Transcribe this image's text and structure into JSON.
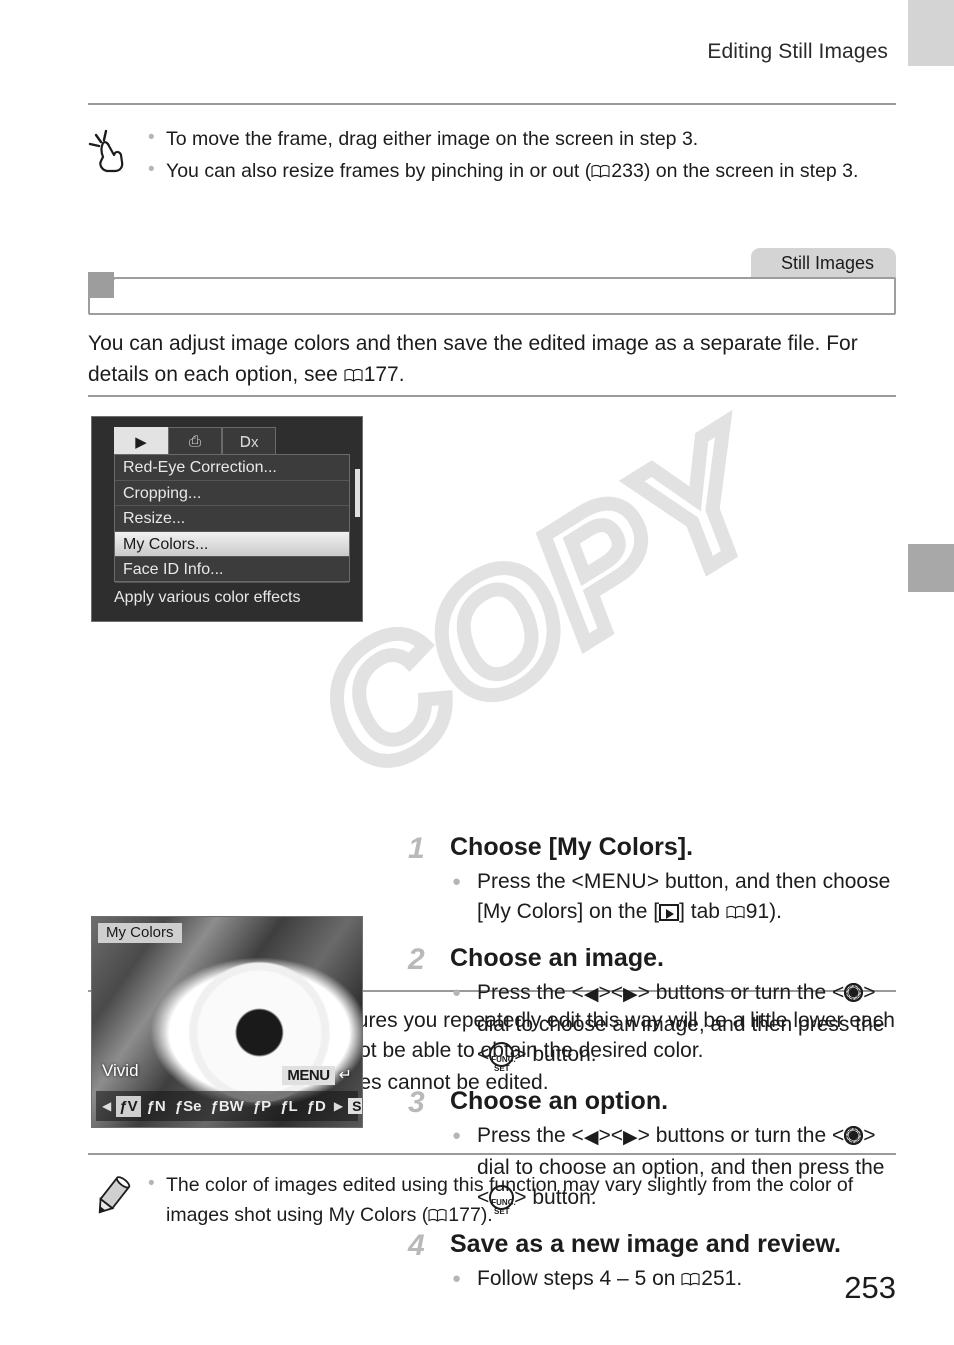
{
  "page": {
    "running_header": "Editing Still Images",
    "page_number": "253"
  },
  "edge_tabs": {
    "top_marker_color": "#d4d4d4",
    "section_marker_color": "#a8a8a8"
  },
  "tip_note": {
    "icon": "tap-hand-icon",
    "bullets": [
      "To move the frame, drag either image on the screen in step 3.",
      "You can also resize frames by pinching in or out ( 233) on the screen in step 3."
    ],
    "bullet2_parts": {
      "before": "You can also resize frames by pinching in or out (",
      "ref_page": "233",
      "after": ") on the screen in step 3."
    }
  },
  "section": {
    "still_images_tab": "Still Images",
    "heading_title": "",
    "intro_before": "You can adjust image colors and then save the edited image as a separate file. For details on each option, see ",
    "intro_ref": "177",
    "intro_after": "."
  },
  "screens": {
    "menu": {
      "name": "camera-menu-screen",
      "tabs": [
        "play-tab",
        "print-tab",
        "settings-tab"
      ],
      "tab_glyphs": [
        "▶",
        "⎙",
        "ƔТ"
      ],
      "rows": [
        "Red-Eye Correction...",
        "Cropping...",
        "Resize...",
        "My Colors...",
        "Face ID Info..."
      ],
      "selected_row_index": 3,
      "hint": "Apply various color effects"
    },
    "photo": {
      "name": "my-colors-preview-screen",
      "label": "My Colors",
      "effect_name": "Vivid",
      "menu_button": "MENU",
      "set_button": "SET",
      "options": [
        "ƒV",
        "ƒN",
        "ƒSe",
        "ƒBW",
        "ƒP",
        "ƒL",
        "ƒD"
      ],
      "selected_option_index": 0
    }
  },
  "steps": [
    {
      "number": "1",
      "title": "Choose [My Colors].",
      "bullets": [
        {
          "parts": [
            {
              "type": "text",
              "value": "Press the <"
            },
            {
              "type": "kbd",
              "value": "MENU"
            },
            {
              "type": "text",
              "value": "> button, and then choose [My Colors] on the ["
            },
            {
              "type": "icon",
              "value": "play-tab-icon"
            },
            {
              "type": "text",
              "value": "] tab "
            },
            {
              "type": "ref",
              "value": "91"
            },
            {
              "type": "text",
              "value": ")."
            }
          ]
        }
      ]
    },
    {
      "number": "2",
      "title": "Choose an image.",
      "bullets": [
        {
          "parts": [
            {
              "type": "text",
              "value": "Press the <"
            },
            {
              "type": "icon",
              "value": "triangle-left-icon"
            },
            {
              "type": "text",
              "value": "><"
            },
            {
              "type": "icon",
              "value": "triangle-right-icon"
            },
            {
              "type": "text",
              "value": "> buttons or turn the <"
            },
            {
              "type": "icon",
              "value": "control-dial-icon"
            },
            {
              "type": "text",
              "value": "> dial to choose an image, and then press the <"
            },
            {
              "type": "icon",
              "value": "func-set-icon"
            },
            {
              "type": "text",
              "value": "> button."
            }
          ]
        }
      ]
    },
    {
      "number": "3",
      "title": "Choose an option.",
      "bullets": [
        {
          "parts": [
            {
              "type": "text",
              "value": "Press the <"
            },
            {
              "type": "icon",
              "value": "triangle-left-icon"
            },
            {
              "type": "text",
              "value": "><"
            },
            {
              "type": "icon",
              "value": "triangle-right-icon"
            },
            {
              "type": "text",
              "value": "> buttons or turn the <"
            },
            {
              "type": "icon",
              "value": "control-dial-icon"
            },
            {
              "type": "text",
              "value": "> dial to choose an option, and then press the <"
            },
            {
              "type": "icon",
              "value": "func-set-icon"
            },
            {
              "type": "text",
              "value": "> button."
            }
          ]
        }
      ]
    },
    {
      "number": "4",
      "title": "Save as a new image and review.",
      "bullets": [
        {
          "parts": [
            {
              "type": "text",
              "value": "Follow steps 4 – 5 on "
            },
            {
              "type": "ref_plain",
              "value": "251"
            },
            {
              "type": "text",
              "value": "."
            }
          ]
        }
      ]
    }
  ],
  "warning_note": {
    "icon": "caution-exclamation-icon",
    "bullets": [
      "Image quality of pictures you repeatedly edit this way will be a little lower each time, and you may not be able to obtain the desired color.",
      "Colors of RAW images cannot be edited."
    ]
  },
  "pencil_note": {
    "icon": "pencil-icon",
    "bullet_before": "The color of images edited using this function may vary slightly from the color of images shot using My Colors (",
    "bullet_ref": "177",
    "bullet_after": ")."
  },
  "watermark": {
    "text": "COPY",
    "color": "#e2e2e2"
  }
}
